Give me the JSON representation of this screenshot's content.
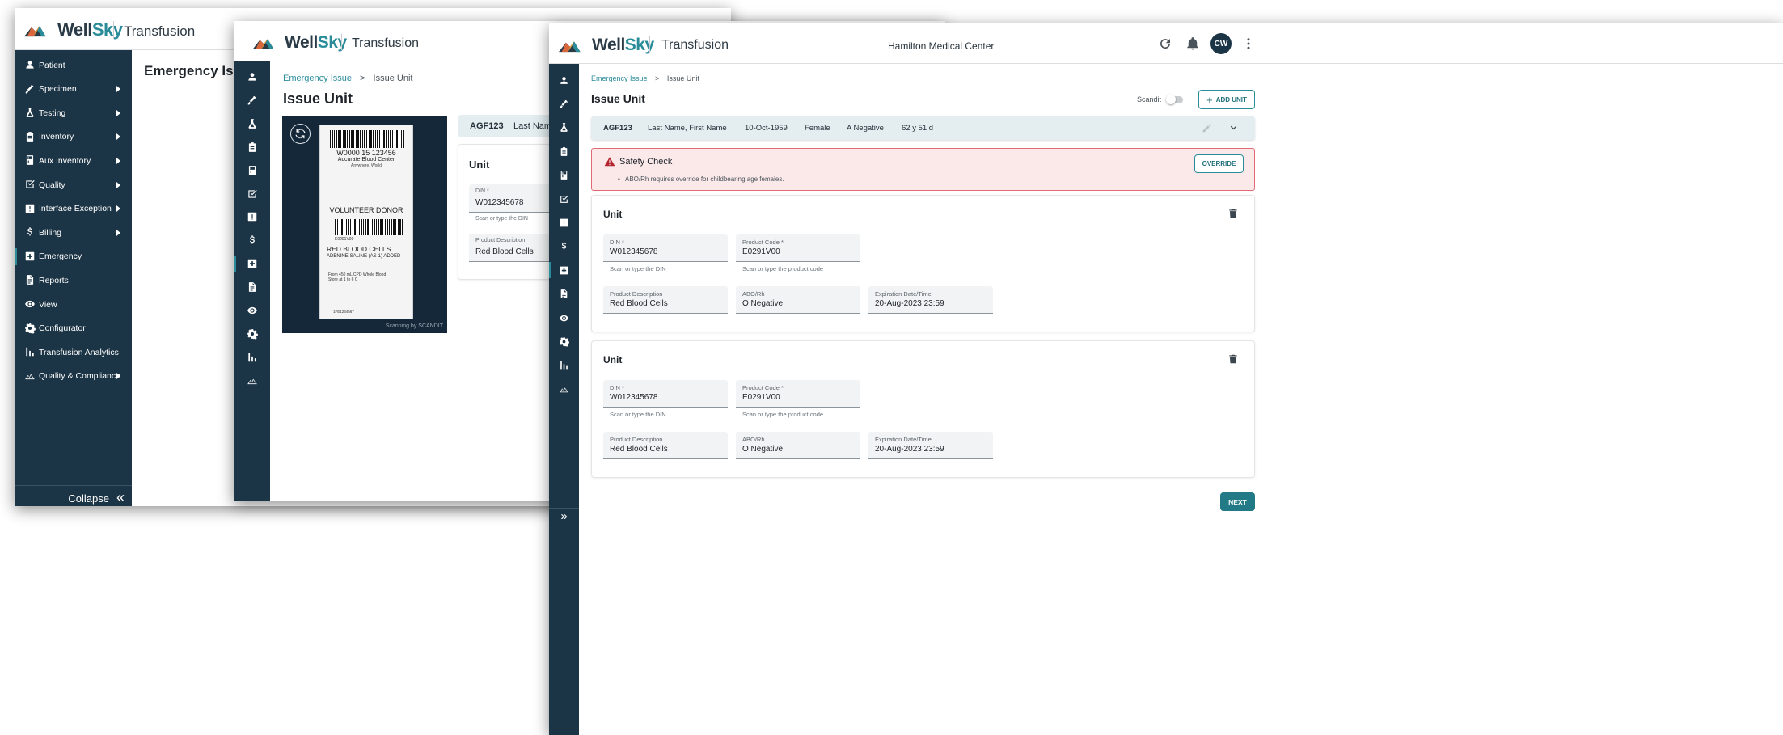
{
  "brand": {
    "logo_main": "Well",
    "logo_accent": "Sky",
    "app_title": "Transfusion"
  },
  "win1": {
    "page_title": "Emergency Issue",
    "nav": [
      {
        "label": "Patient",
        "icon": "person-icon",
        "arrow": false
      },
      {
        "label": "Specimen",
        "icon": "syringe-icon",
        "arrow": true
      },
      {
        "label": "Testing",
        "icon": "flask-icon",
        "arrow": true
      },
      {
        "label": "Inventory",
        "icon": "clipboard-icon",
        "arrow": true
      },
      {
        "label": "Aux Inventory",
        "icon": "fridge-icon",
        "arrow": true
      },
      {
        "label": "Quality",
        "icon": "checkbox-icon",
        "arrow": true
      },
      {
        "label": "Interface Exception",
        "icon": "exclamation-icon",
        "arrow": true
      },
      {
        "label": "Billing",
        "icon": "dollar-icon",
        "arrow": true
      },
      {
        "label": "Emergency",
        "icon": "medical-plus-icon",
        "arrow": false
      },
      {
        "label": "Reports",
        "icon": "document-icon",
        "arrow": false
      },
      {
        "label": "View",
        "icon": "eye-icon",
        "arrow": false
      },
      {
        "label": "Configurator",
        "icon": "gear-icon",
        "arrow": false
      },
      {
        "label": "Transfusion Analytics",
        "icon": "bar-chart-icon",
        "arrow": false
      },
      {
        "label": "Quality & Compliance",
        "icon": "mountain-icon",
        "arrow": true
      }
    ],
    "collapse_label": "Collapse"
  },
  "win2": {
    "breadcrumb": {
      "parent": "Emergency Issue",
      "sep": ">",
      "current": "Issue Unit"
    },
    "page_title": "Issue Unit",
    "patient_id": "AGF123",
    "patient_name_partial": "Last Name",
    "unit_title": "Unit",
    "din_label": "DIN *",
    "din_value": "W012345678",
    "din_hint": "Scan or type the DIN",
    "desc_label": "Product Description",
    "desc_value": "Red Blood Cells",
    "scan": {
      "code": "W0000 15 123456",
      "center": "Accurate Blood Center",
      "location": "Anywhere, World",
      "donor": "VOLUNTEER DONOR",
      "product_code": "E0291V00",
      "product": "RED BLOOD CELLS",
      "additive": "ADENINE-SALINE (AS-1) ADDED",
      "note1": "From 450 mL CPD Whole Blood",
      "note2": "Store at 1 to 6 C",
      "footer_code": "1FE1234567",
      "credit": "Scanning by SCANDIT"
    }
  },
  "win3": {
    "facility": "Hamilton Medical Center",
    "avatar": "CW",
    "breadcrumb": {
      "parent": "Emergency Issue",
      "sep": ">",
      "current": "Issue Unit"
    },
    "page_title": "Issue Unit",
    "scandit_label": "Scandit",
    "add_unit_label": "ADD UNIT",
    "patient": {
      "id": "AGF123",
      "name": "Last Name, First Name",
      "dob": "10-Oct-1959",
      "sex": "Female",
      "blood_type": "A Negative",
      "age": "62 y 51 d"
    },
    "safety": {
      "title": "Safety Check",
      "message": "ABO/Rh requires override for childbearing age females.",
      "override_label": "OVERRIDE"
    },
    "units": [
      {
        "title": "Unit",
        "din_label": "DIN *",
        "din_value": "W012345678",
        "din_hint": "Scan or type the DIN",
        "code_label": "Product Code *",
        "code_value": "E0291V00",
        "code_hint": "Scan or type the product code",
        "desc_label": "Product Description",
        "desc_value": "Red Blood Cells",
        "abo_label": "ABO/Rh",
        "abo_value": "O Negative",
        "exp_label": "Expiration Date/Time",
        "exp_value": "20-Aug-2023 23:59"
      },
      {
        "title": "Unit",
        "din_label": "DIN *",
        "din_value": "W012345678",
        "din_hint": "Scan or type the DIN",
        "code_label": "Product Code *",
        "code_value": "E0291V00",
        "code_hint": "Scan or type the product code",
        "desc_label": "Product Description",
        "desc_value": "Red Blood Cells",
        "abo_label": "ABO/Rh",
        "abo_value": "O Negative",
        "exp_label": "Expiration Date/Time",
        "exp_value": "20-Aug-2023 23:59"
      }
    ],
    "next_label": "NEXT"
  },
  "colors": {
    "sidebar": "#1c3546",
    "accent": "#2a8c99",
    "alert_bg": "#fbe9ea",
    "alert_border": "#e06a74",
    "patient_bar": "#e4eef1"
  }
}
